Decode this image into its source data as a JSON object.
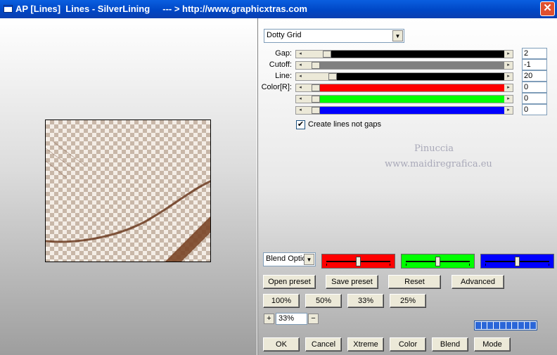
{
  "window": {
    "title": "AP [Lines]  Lines - SilverLining     --- > http://www.graphicxtras.com",
    "close_label": "✕"
  },
  "filter": {
    "preset": "Dotty Grid",
    "sliders": [
      {
        "label": "Gap:",
        "value": "2",
        "track": "#000000",
        "level": 0.06
      },
      {
        "label": "Cutoff:",
        "value": "-1",
        "track": "#808080",
        "level": 0.0
      },
      {
        "label": "Line:",
        "value": "20",
        "track": "#000000",
        "level": 0.09
      },
      {
        "label": "Color[R]:",
        "value": "0",
        "track": "#ff0000",
        "level": 0.0
      },
      {
        "label": "",
        "value": "0",
        "track": "#00ff00",
        "level": 0.0
      },
      {
        "label": "",
        "value": "0",
        "track": "#0000ff",
        "level": 0.0
      }
    ],
    "create_lines_label": "Create lines not gaps",
    "create_lines_checked": true,
    "watermark_lines": [
      "Pinuccia",
      "www.maidiregrafica.eu"
    ]
  },
  "blend": {
    "selected": "Blend Optio",
    "bars": [
      {
        "color": "#ff0000",
        "level": 0.5
      },
      {
        "color": "#00ff00",
        "level": 0.5
      },
      {
        "color": "#0000ff",
        "level": 0.5
      }
    ]
  },
  "buttons": {
    "open_preset": "Open preset",
    "save_preset": "Save preset",
    "reset": "Reset",
    "advanced": "Advanced",
    "z100": "100%",
    "z50": "50%",
    "z33": "33%",
    "z25": "25%",
    "ok": "OK",
    "cancel": "Cancel",
    "xtreme": "Xtreme",
    "color": "Color",
    "blend": "Blend",
    "mode": "Mode"
  },
  "zoom": {
    "plus": "+",
    "value": "33%",
    "minus": "−"
  },
  "progress_segments": 10
}
